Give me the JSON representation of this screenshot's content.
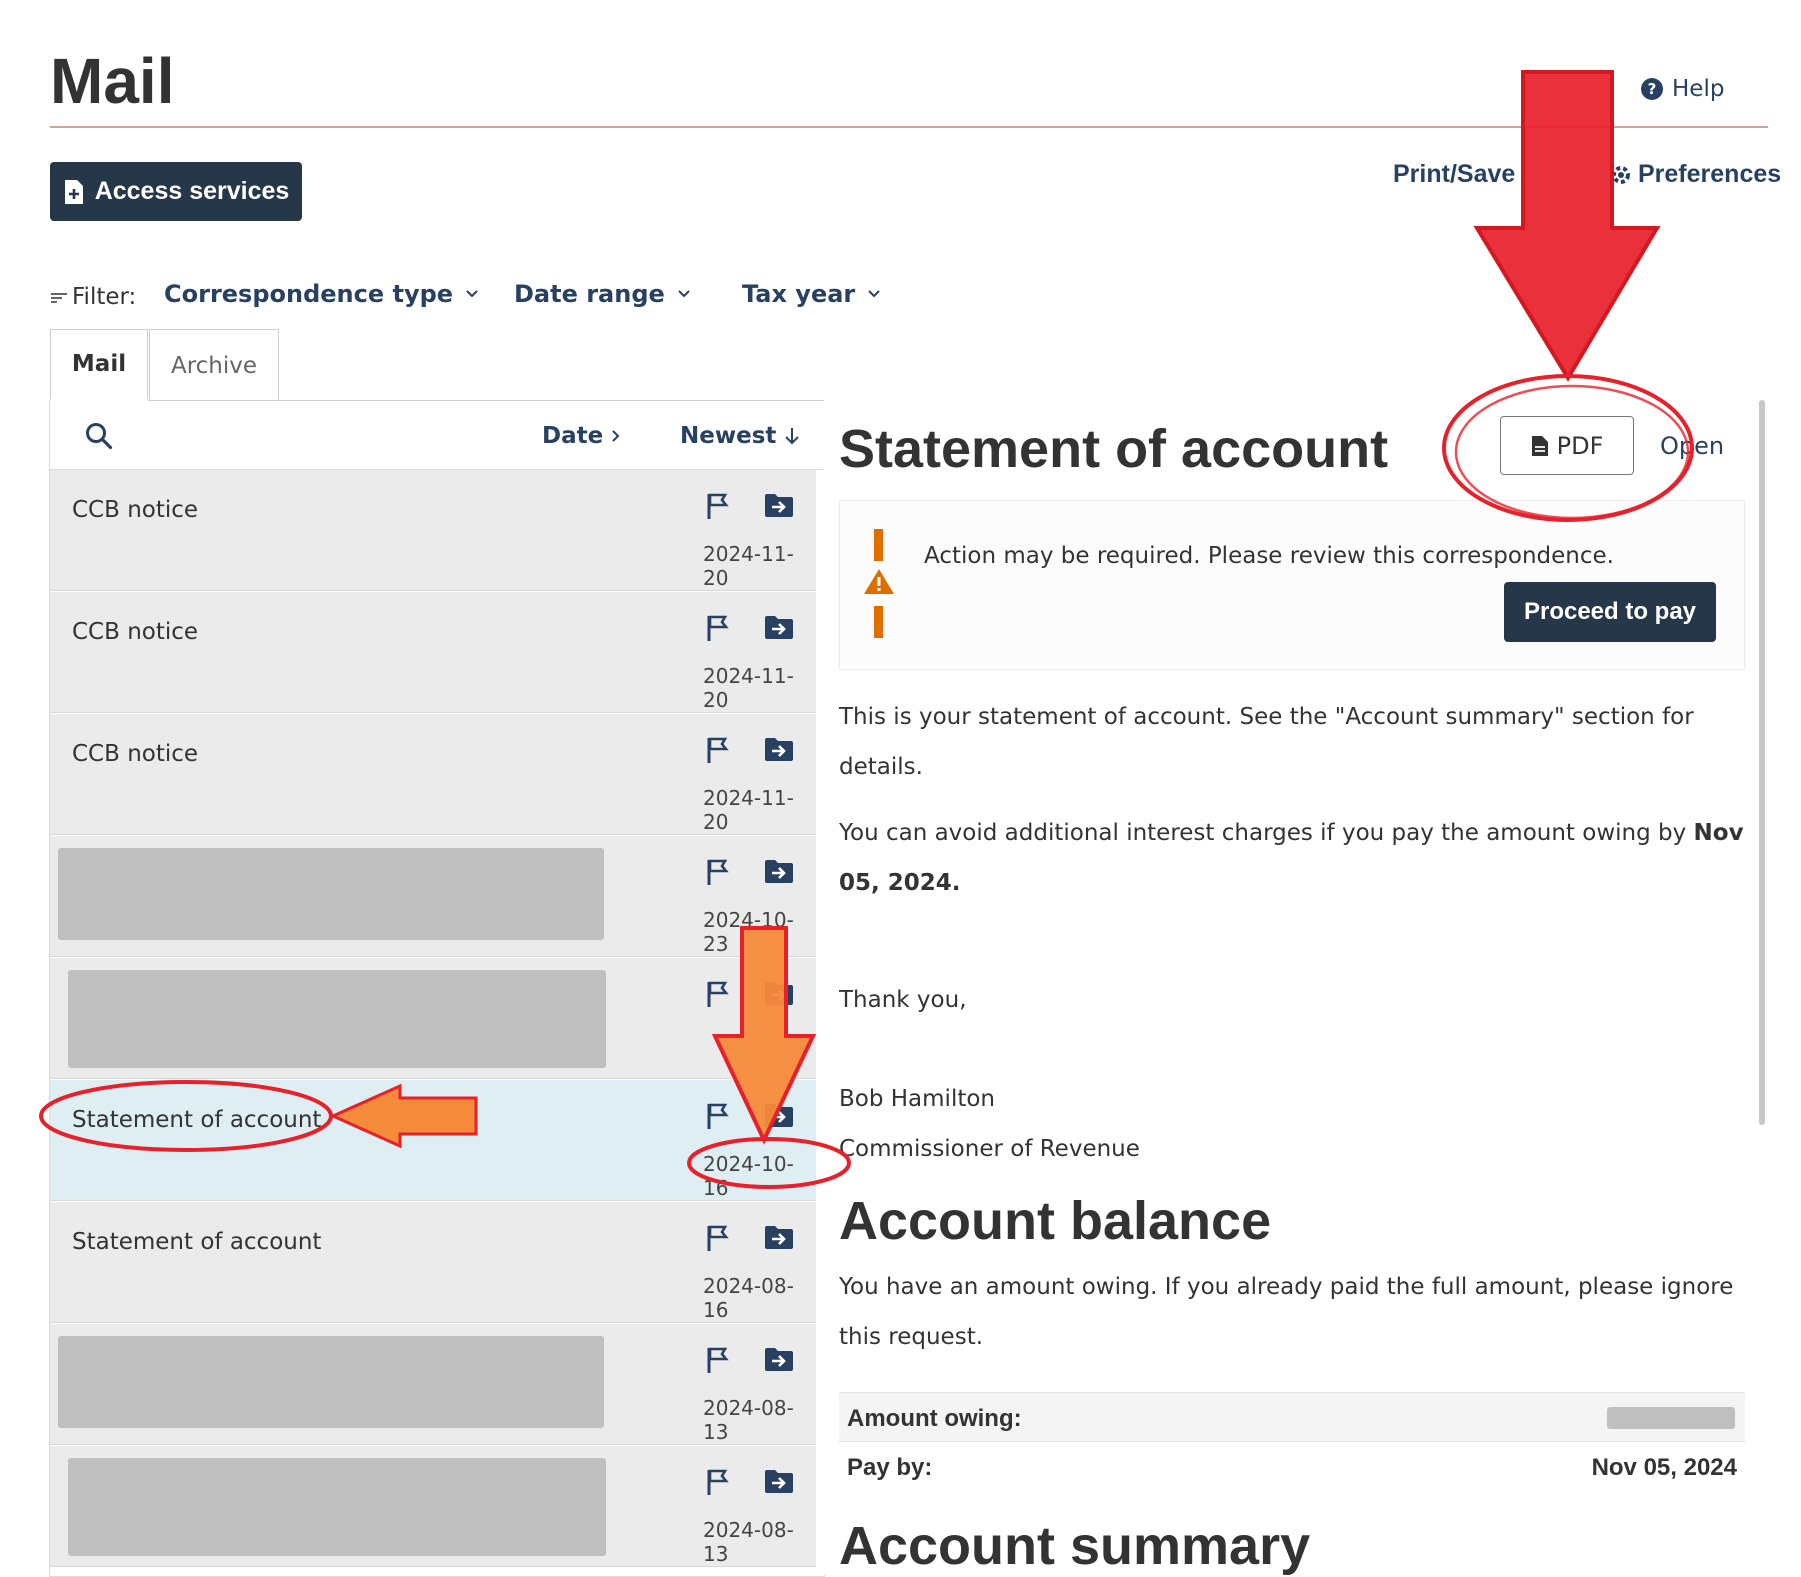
{
  "header": {
    "title": "Mail",
    "help_label": "Help",
    "access_services_label": "Access services",
    "print_save_label": "Print/Save",
    "preferences_label": "Preferences"
  },
  "filters": {
    "label": "Filter:",
    "correspondence_type": "Correspondence type",
    "date_range": "Date range",
    "tax_year": "Tax year"
  },
  "tabs": [
    {
      "label": "Mail",
      "active": true
    },
    {
      "label": "Archive",
      "active": false
    }
  ],
  "list": {
    "sort_field": "Date",
    "sort_order": "Newest",
    "items": [
      {
        "title": "CCB notice",
        "date": "2024-11-20",
        "redacted": false,
        "selected": false
      },
      {
        "title": "CCB notice",
        "date": "2024-11-20",
        "redacted": false,
        "selected": false
      },
      {
        "title": "CCB notice",
        "date": "2024-11-20",
        "redacted": false,
        "selected": false
      },
      {
        "title": "",
        "date": "2024-10-23",
        "redacted": true,
        "selected": false
      },
      {
        "title": "",
        "date": "",
        "redacted": true,
        "selected": false
      },
      {
        "title": "Statement of account",
        "date": "2024-10-16",
        "redacted": false,
        "selected": true
      },
      {
        "title": "Statement of account",
        "date": "2024-08-16",
        "redacted": false,
        "selected": false
      },
      {
        "title": "",
        "date": "2024-08-13",
        "redacted": true,
        "selected": false
      },
      {
        "title": "",
        "date": "2024-08-13",
        "redacted": true,
        "selected": false
      }
    ]
  },
  "detail": {
    "title": "Statement of account",
    "pdf_label": "PDF",
    "open_label": "Open",
    "alert_text": "Action may be required. Please review this correspondence.",
    "proceed_label": "Proceed to pay",
    "para1": "This is your statement of account. See the \"Account summary\" section for details.",
    "para2_prefix": "You can avoid additional interest charges if you pay the amount owing by ",
    "para2_bold": "Nov 05, 2024.",
    "thanks": "Thank you,",
    "signer_name": "Bob Hamilton",
    "signer_title": "Commissioner of Revenue",
    "balance_heading": "Account balance",
    "balance_text": "You have an amount owing. If you already paid the full amount, please ignore this request.",
    "amount_owing_label": "Amount owing:",
    "pay_by_label": "Pay by:",
    "pay_by_value": "Nov 05, 2024",
    "summary_heading": "Account summary"
  },
  "colors": {
    "navy": "#26374a",
    "link": "#284162",
    "warning": "#e06d00",
    "annotation_red": "#e8202a",
    "annotation_orange": "#f58a3a",
    "selected_row": "#dfeef3"
  }
}
